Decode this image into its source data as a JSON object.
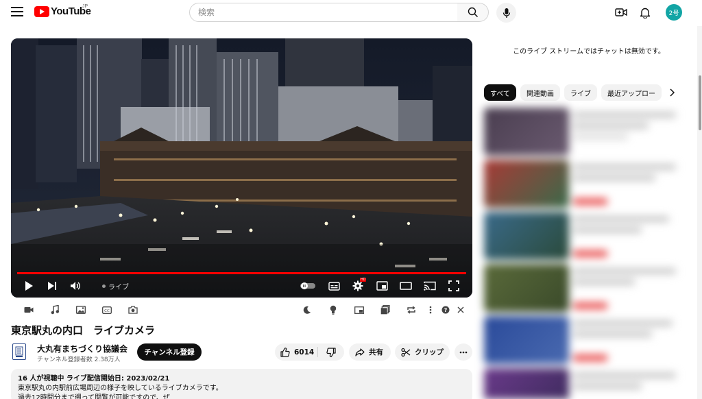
{
  "header": {
    "logo_text": "YouTube",
    "logo_country": "JP",
    "search_placeholder": "検索",
    "avatar_label": "2号"
  },
  "player": {
    "live_label": "ライブ",
    "hd_badge": "HD",
    "progress": 1.0,
    "progress_color": "#ff0000"
  },
  "video": {
    "title": "東京駅丸の内口　ライブカメラ",
    "channel_name": "大丸有まちづくり協議会",
    "channel_subs": "チャンネル登録者数 2.38万人",
    "subscribe_label": "チャンネル登録",
    "like_count": "6014",
    "share_label": "共有",
    "clip_label": "クリップ"
  },
  "description": {
    "meta": "16 人が視聴中  ライブ配信開始日: 2023/02/21",
    "line1": "東京駅丸の内駅前広場周辺の様子を映しているライブカメラです。",
    "line2": "過去12時間分まで遡って閲覧が可能ですので、ぜ"
  },
  "sidebar": {
    "chat_disabled": "このライブ ストリームではチャットは無効です。",
    "chips": [
      "すべて",
      "関連動画",
      "ライブ",
      "最近アップロー"
    ]
  },
  "colors": {
    "accent": "#ff0000",
    "avatar_bg": "#12a5a5",
    "chip_active": "#0f0f0f"
  }
}
